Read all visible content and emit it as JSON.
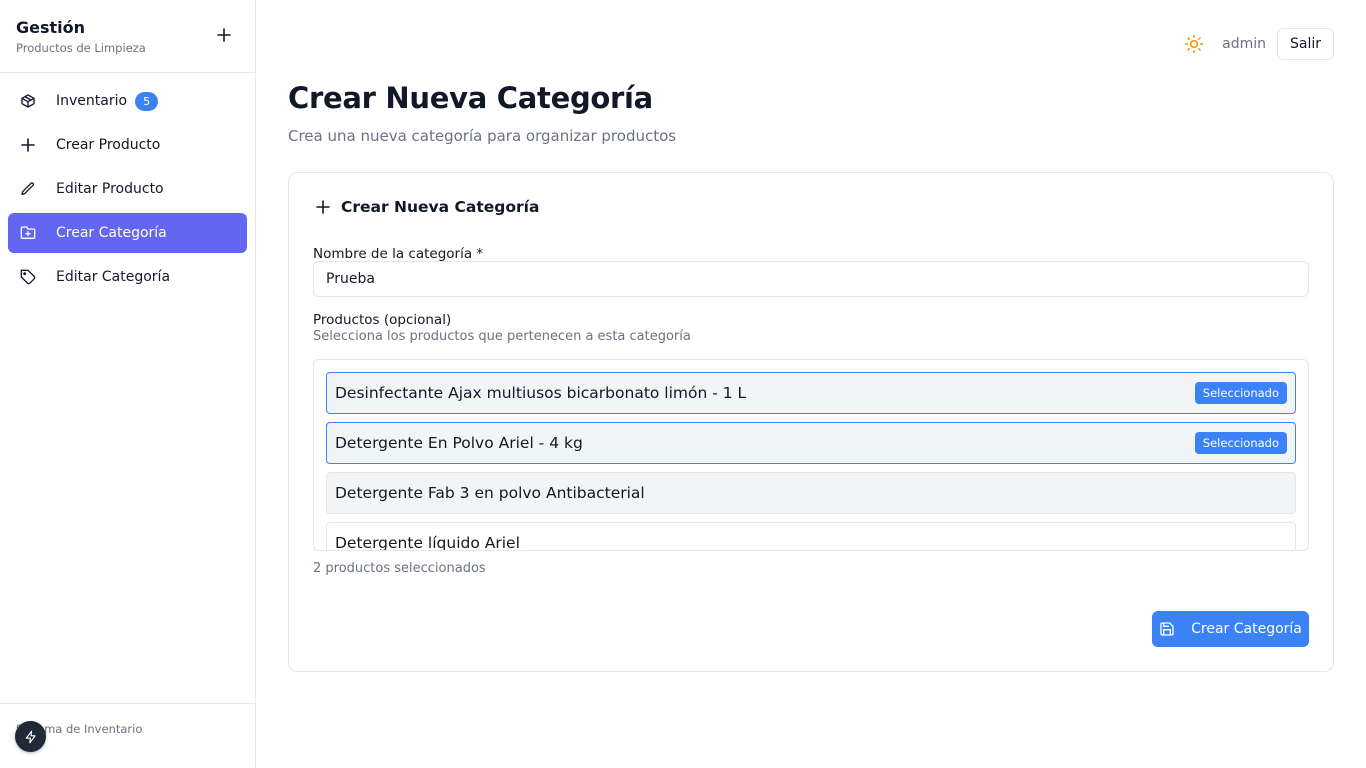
{
  "sidebar": {
    "brand_title": "Gestión",
    "brand_subtitle": "Productos de Limpieza",
    "items": [
      {
        "label": "Inventario",
        "icon": "box-icon",
        "badge": "5",
        "active": false
      },
      {
        "label": "Crear Producto",
        "icon": "plus-icon",
        "active": false
      },
      {
        "label": "Editar Producto",
        "icon": "pencil-icon",
        "active": false
      },
      {
        "label": "Crear Categoría",
        "icon": "folder-plus-icon",
        "active": true
      },
      {
        "label": "Editar Categoría",
        "icon": "tag-icon",
        "active": false
      }
    ],
    "footer_text": "Sistema de Inventario"
  },
  "header": {
    "user": "admin",
    "logout_label": "Salir",
    "theme_icon": "sun-icon",
    "theme_icon_color": "#f59e0b"
  },
  "page": {
    "title": "Crear Nueva Categoría",
    "subtitle": "Crea una nueva categoría para organizar productos"
  },
  "form": {
    "card_title": "Crear Nueva Categoría",
    "name_label": "Nombre de la categoría *",
    "name_value": "Prueba",
    "products_label": "Productos (opcional)",
    "products_help": "Selecciona los productos que pertenecen a esta categoría",
    "products": [
      {
        "name": "Desinfectante Ajax multiusos bicarbonato limón - 1 L",
        "selected": true,
        "badge": "Seleccionado"
      },
      {
        "name": "Detergente En Polvo Ariel - 4 kg",
        "selected": true,
        "badge": "Seleccionado"
      },
      {
        "name": "Detergente Fab 3 en polvo Antibacterial",
        "selected": false
      },
      {
        "name": "Detergente líquido Ariel",
        "selected": false
      }
    ],
    "selected_count_text": "2 productos seleccionados",
    "submit_label": "Crear Categoría"
  },
  "colors": {
    "accent": "#6366f1",
    "primary": "#3b82f6"
  }
}
